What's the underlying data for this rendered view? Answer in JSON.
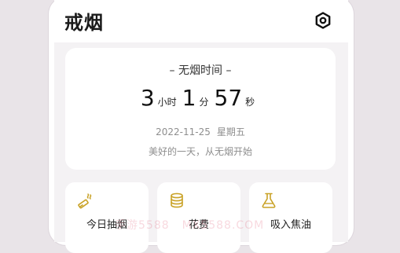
{
  "header": {
    "title": "戒烟",
    "settings_icon": "settings-hexagon-icon"
  },
  "timer_card": {
    "section_title": "– 无烟时间 –",
    "hours": "3",
    "hours_unit": "小时",
    "minutes": "1",
    "minutes_unit": "分",
    "seconds": "57",
    "seconds_unit": "秒",
    "date": "2022-11-25",
    "weekday": "星期五",
    "motto": "美好的一天，从无烟开始"
  },
  "tiles": [
    {
      "label": "今日抽烟",
      "icon": "cigarette-icon"
    },
    {
      "label": "花费",
      "icon": "coins-icon"
    },
    {
      "label": "吸入焦油",
      "icon": "flask-icon"
    }
  ],
  "watermark": {
    "text1": "手游5588",
    "text2": "MX5588.COM"
  },
  "colors": {
    "accent_gold": "#c9a227",
    "background": "#f4f2f4",
    "card": "#ffffff"
  }
}
